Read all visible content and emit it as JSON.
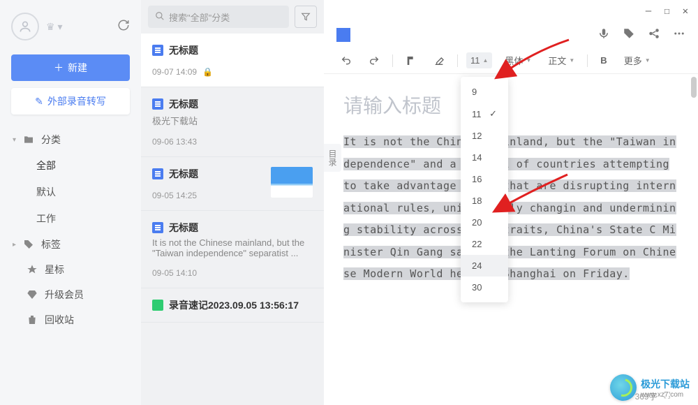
{
  "sidebar": {
    "new_btn": "新建",
    "ext_btn": "外部录音转写",
    "groups": {
      "category": {
        "label": "分类",
        "items": [
          "全部",
          "默认",
          "工作"
        ],
        "active": 0
      },
      "tags": {
        "label": "标签"
      }
    },
    "fixed": [
      "星标",
      "升级会员",
      "回收站"
    ]
  },
  "search": {
    "placeholder": "搜索\"全部\"分类"
  },
  "notes": [
    {
      "title": "无标题",
      "sub": "",
      "time": "09-07 14:09",
      "locked": true,
      "active": true,
      "icon": "doc"
    },
    {
      "title": "无标题",
      "sub": "极光下载站",
      "time": "09-06 13:43",
      "icon": "doc"
    },
    {
      "title": "无标题",
      "sub": "",
      "time": "09-05 14:25",
      "thumb": true,
      "icon": "doc"
    },
    {
      "title": "无标题",
      "sub": "It is not the Chinese mainland, but the \"Taiwan independence\" separatist ...",
      "time": "09-05 14:10",
      "icon": "doc"
    },
    {
      "title": "录音速记2023.09.05 13:56:17",
      "sub": "",
      "time": "",
      "icon": "rec"
    }
  ],
  "toolbar": {
    "fontsize": "11",
    "font": "黑体",
    "para": "正文",
    "more": "更多"
  },
  "fontsizes": [
    "9",
    "11",
    "12",
    "14",
    "16",
    "18",
    "20",
    "22",
    "24",
    "30"
  ],
  "fontsize_selected": "11",
  "fontsize_hover": "24",
  "doc": {
    "title_placeholder": "请输入标题",
    "side_tab": "目录",
    "body": "It is not the Chinese mainland, but the \"Taiwan independence\" and a handful of countries attempting to take advantage of \"T that are disrupting international rules, unilaterally changin and undermining stability across the Straits, China's State C Minister Qin Gang said at the Lanting Forum on Chinese Modern World held in Shanghai on Friday."
  },
  "status": {
    "words": "369字"
  },
  "watermark": {
    "name": "极光下载站",
    "url": "www.xz7.com"
  }
}
